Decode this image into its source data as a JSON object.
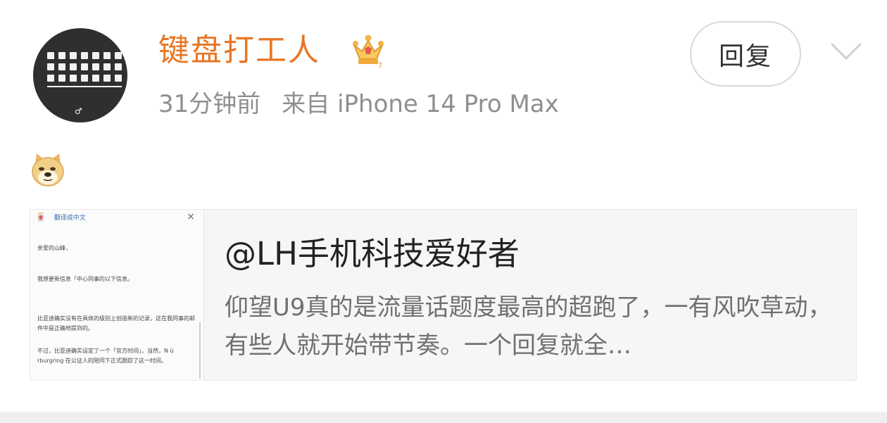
{
  "post": {
    "username": "键盘打工人",
    "time": "31分钟前",
    "source": "来自 iPhone 14 Pro Max",
    "reply_label": "回复",
    "icons": {
      "avatar": "keyboard-avatar-icon",
      "badge": "crown-badge-icon",
      "more": "chevron-down-icon",
      "emoji": "doge-emoji-icon"
    }
  },
  "share": {
    "title": "@LH手机科技爱好者",
    "text": "仰望U9真的是流量话题度最高的超跑了，一有风吹草动，有些人就开始带节奏。一个回复就全…",
    "thumb": {
      "translate_label": "翻译成中文",
      "close": "×",
      "lines": [
        "亲爱的山峰，",
        "我想更新信息「中心同事的以下信息。",
        "比亚迪确实没有在具体的级别上创造新的记录，这在我同事的邮件中是正确地提到的。",
        "不过，比亚迪确实设定了一个「官方时间」，当然，N ü rburgring 在公证人的陪同下正式跟踪了这一时间。"
      ]
    }
  },
  "colors": {
    "username": "#e77623",
    "meta": "#8f8f8f",
    "card_bg": "#f6f6f6",
    "bottom_bar": "#efefef"
  }
}
